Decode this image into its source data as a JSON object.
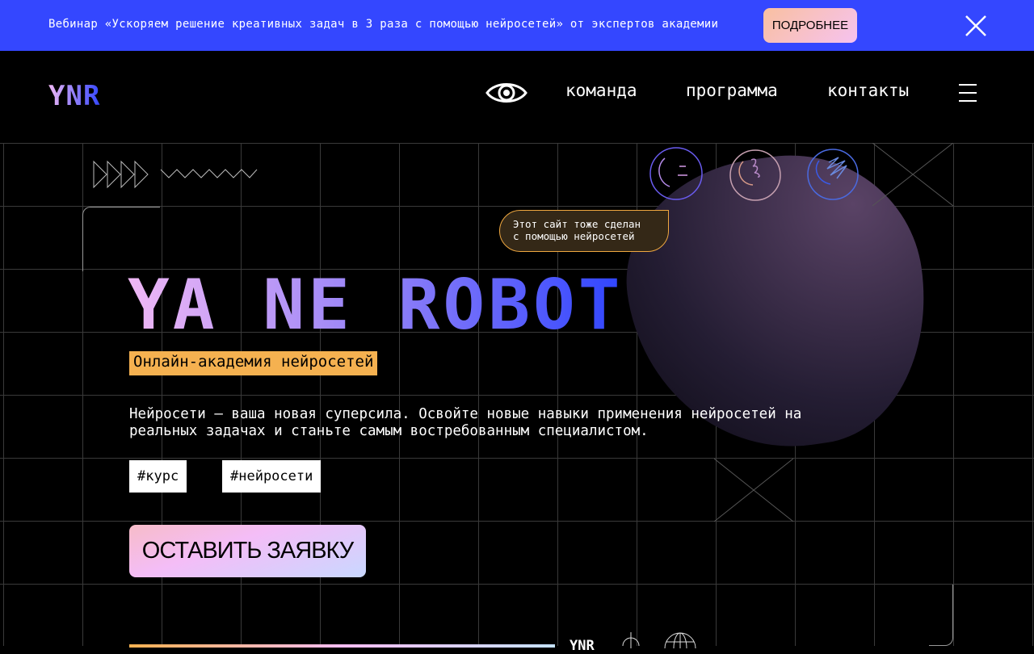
{
  "banner": {
    "text": "Вебинар «Ускоряем решение креативных задач в 3 раза с помощью нейросетей» от экспертов академии",
    "button": "ПОДРОБНЕЕ"
  },
  "header": {
    "logo": "YNR",
    "nav": [
      "команда",
      "программа",
      "контакты"
    ]
  },
  "hero": {
    "tooltip": "Этот сайт тоже сделан\nс помощью нейросетей",
    "title": "YA NE ROBOT",
    "subtitle": "Онлайн-академия нейросетей",
    "description": "Нейросети — ваша новая суперсила. Освойте новые навыки применения нейросетей на реальных задачах и станьте самым востребованным специалистом.",
    "tags": [
      "#курс",
      "#нейросети"
    ],
    "cta": "ОСТАВИТЬ ЗАЯВКУ"
  },
  "footer": {
    "logo": "YNR"
  }
}
